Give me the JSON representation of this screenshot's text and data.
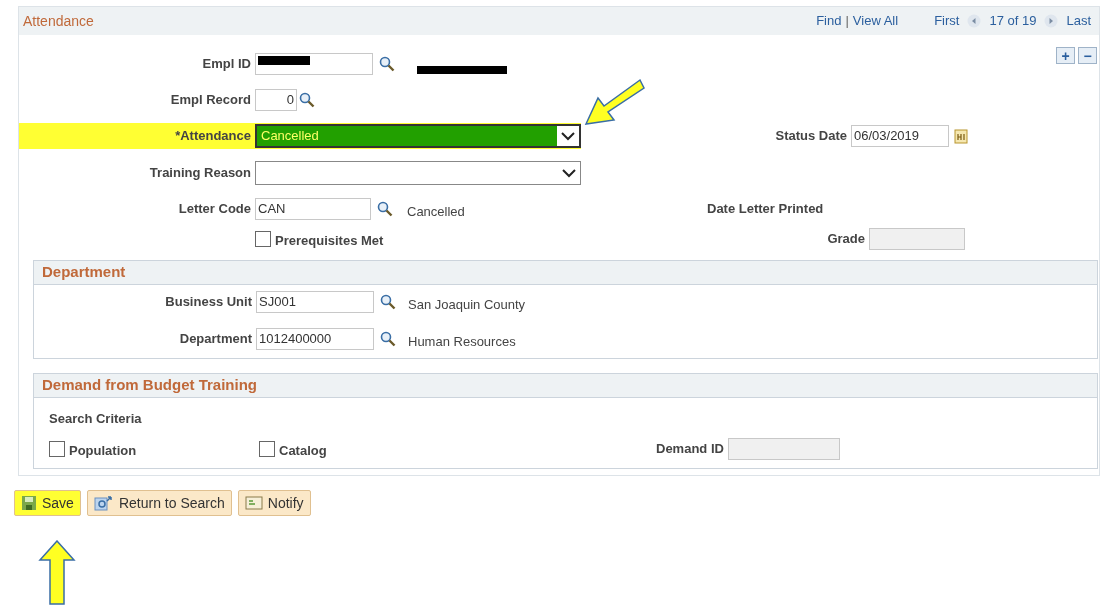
{
  "header": {
    "title": "Attendance",
    "links": [
      "Find",
      "View All"
    ],
    "separator": "|",
    "first": "First",
    "position": "17 of 19",
    "last": "Last"
  },
  "row_buttons": [
    "+",
    "−"
  ],
  "empl_id": {
    "label": "Empl ID",
    "redacted": true,
    "name_redacted": true
  },
  "empl_record": {
    "label": "Empl Record",
    "value": "0"
  },
  "attendance": {
    "label": "*Attendance",
    "value": "Cancelled",
    "highlighted": true
  },
  "status_date": {
    "label": "Status Date",
    "value": "06/03/2019"
  },
  "training_reason": {
    "label": "Training Reason"
  },
  "letter_code": {
    "label": "Letter Code",
    "value": "CAN",
    "description": "Cancelled"
  },
  "date_letter_printed": {
    "label": "Date Letter Printed"
  },
  "prerequisites": {
    "label": "Prerequisites Met",
    "checked": false
  },
  "grade": {
    "label": "Grade"
  },
  "department_section": {
    "title": "Department",
    "fields": [
      {
        "label": "Business Unit",
        "value": "SJ001",
        "description": "San Joaquin County"
      },
      {
        "label": "Department",
        "value": "1012400000",
        "description": "Human Resources"
      }
    ]
  },
  "demand_section": {
    "title": "Demand from Budget Training",
    "subtitle": "Search Criteria",
    "checkboxes": [
      {
        "label": "Population",
        "checked": false
      },
      {
        "label": "Catalog",
        "checked": false
      }
    ],
    "demand_id": {
      "label": "Demand ID"
    }
  },
  "buttons": [
    {
      "kind": "save",
      "label": "Save",
      "highlighted": true
    },
    {
      "kind": "return",
      "label": "Return to Search",
      "highlighted": false
    },
    {
      "kind": "notify",
      "label": "Notify",
      "highlighted": false
    }
  ]
}
